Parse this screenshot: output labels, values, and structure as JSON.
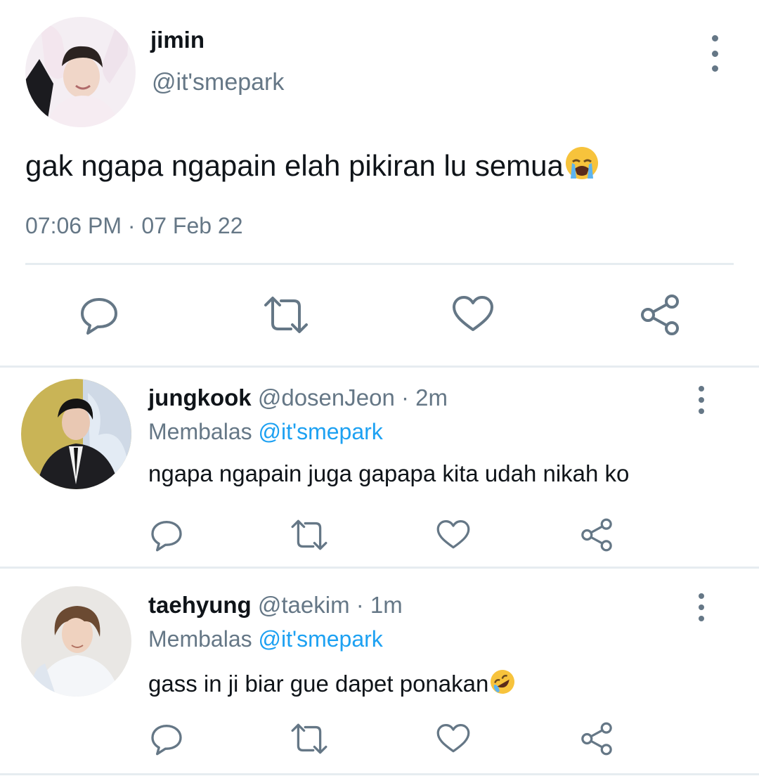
{
  "main_tweet": {
    "name": "jimin",
    "handle": "@it'smepark",
    "text": "gak ngapa ngapain elah pikiran lu semua",
    "emoji": "loudly-crying-face",
    "time": "07:06 PM",
    "separator": "·",
    "date": "07 Feb 22"
  },
  "replies": [
    {
      "name": "jungkook",
      "handle": "@dosenJeon",
      "separator": "·",
      "age": "2m",
      "reply_prefix": "Membalas",
      "reply_to": "@it'smepark",
      "text": "ngapa ngapain juga gapapa kita udah nikah ko"
    },
    {
      "name": "taehyung",
      "handle": "@taekim",
      "separator": "·",
      "age": "1m",
      "reply_prefix": "Membalas",
      "reply_to": "@it'smepark",
      "text": "gass in ji biar gue dapet ponakan",
      "emoji": "rolling-on-the-floor-laughing"
    }
  ],
  "colors": {
    "text": "#0f1419",
    "secondary": "#657786",
    "mention": "#1da1f2",
    "divider": "#e6ecf0"
  }
}
